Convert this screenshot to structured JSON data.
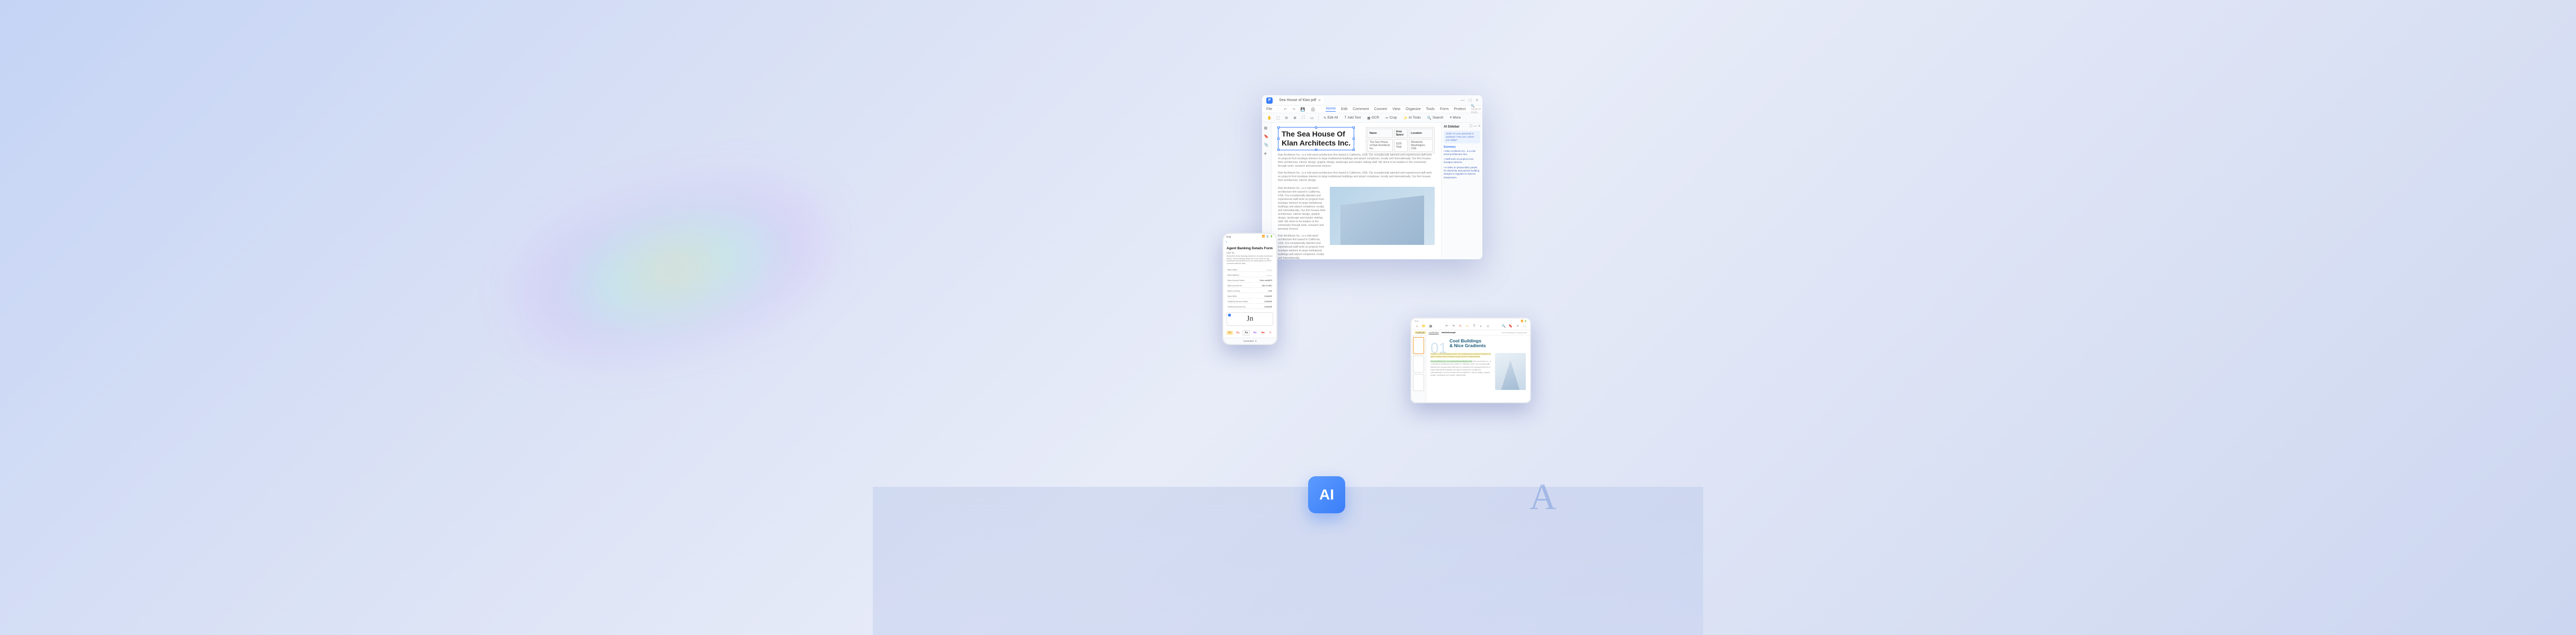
{
  "desktop": {
    "tab_title": "Sea House of Klan.pdf",
    "file_menu": "File",
    "menu": [
      "Home",
      "Edit",
      "Comment",
      "Convert",
      "View",
      "Organize",
      "Tools",
      "Form",
      "Protect"
    ],
    "search_placeholder": "Search tools",
    "toolbar": {
      "edit_all": "Edit All",
      "add_text": "Add Text",
      "ocr": "OCR",
      "crop": "Crop",
      "ai_tools": "AI Tools",
      "search": "Search",
      "more": "More"
    },
    "doc_title_line1": "The Sea House Of",
    "doc_title_line2": "Klan Architects Inc.",
    "table": {
      "headers": [
        "Name",
        "Area Space",
        "Location"
      ],
      "row": [
        "The Sea House of Klan Architects Inc.",
        "5325 Total",
        "Westwork, Washington, USA"
      ]
    },
    "para1": "Klan Architects Inc., is a mid-sized architecture firm based in California, USA. Our exceptionally talented and experienced staff work on projects from boutique interiors to large institutional buildings and airport complexes, locally and internationally. Our firm houses their architecture, interior design, graphic design, landscape and master making staff. We strive to be leaders in the community through work, research and personal choices.",
    "para2": "Klan Architects Inc., is a mid-sized architecture firm based in California, USA. Our exceptionally talented and experienced staff work on projects from boutique interiors to large institutional buildings and airport complexes, locally and internationally. Our firm houses their architecture, interior design.",
    "col_text": "Klan Architects Inc., is a mid-sized architecture firm based in California, USA. Our exceptionally talented and experienced staff work on projects from boutique interiors to large institutional buildings and airport complexes, locally and internationally. Our firm houses their architecture, interior design, graphic design, landscape and master making staff. We strive to be leaders in the community through work, research and personal choices.",
    "col_text2": "Klan Architects Inc., is a mid-sized architecture firm based in California, USA. Our exceptionally talented and experienced staff work on projects from boutique interiors to large institutional buildings and airport complexes, locally and internationally.",
    "ai_sidebar": {
      "title": "AI Sidebar",
      "bubble": "Hello! I'm your personal AI assistant. How can I assist you today?",
      "section": "Summary",
      "item1": "• Klan Architects Inc., is a mid-sized architecture firm.",
      "item2": "• Staff work on projects from boutique interiors.",
      "item3": "• It relies on photovoltaic panels for electricity and passive building designs to regulate its internal temperature."
    }
  },
  "mobile": {
    "time": "9:41",
    "title": "Agent Banking Details Form",
    "greeting": "Dear Sir,",
    "body": "Kindly find below banking details for all sales mentioned above. These banking details are to be used for any remittance transactions from our sales based on MT03 Cascade effective date.",
    "rows": [
      [
        "Bank Name",
        "———"
      ],
      [
        "Bank Address",
        "———"
      ],
      [
        "Bank Account Name",
        "Odom sodfaEN"
      ],
      [
        "Bank Account No.",
        "456 XX ABC"
      ],
      [
        "Bank Currency",
        "UAE"
      ],
      [
        "Bank IBAN",
        "CANAME"
      ],
      [
        "Swift/Key Account Name",
        "CANAME"
      ],
      [
        "Swift/Key Account No.",
        "CANAME"
      ]
    ],
    "bottom_label": "Comment"
  },
  "tablet": {
    "time": "9:41",
    "fmt_labels": [
      "Highlight",
      "Underline",
      "Strikethrough"
    ],
    "essential": "The Essential Components",
    "num": "01",
    "title_line1": "Cool Buildings",
    "title_line2": "& Nice Gradients",
    "text1": "Housed in the international hotel, the contemporary residence features an open-concept layout creating a great sense of spaciousness.",
    "text2": "Klan Architects Inc., is a mid-sized architecture firm based in California, USA. Our exceptionally talented and experienced staff work on projects from boutique interiors to large institutional buildings and airport complexes, locally and internationally. Our firm houses their architecture, interior design, graphic design, landscape and master making staff."
  },
  "ai_badge": "AI"
}
